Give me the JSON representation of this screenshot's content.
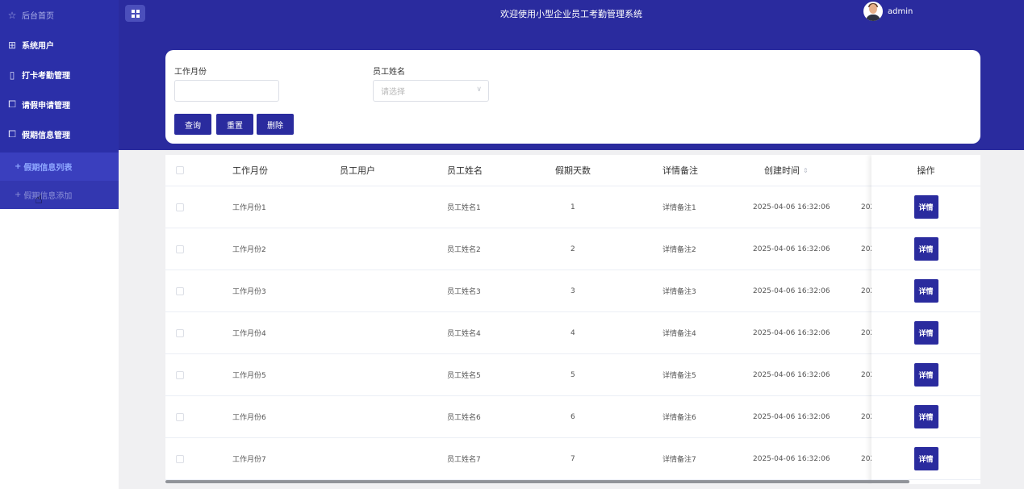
{
  "sidebar": {
    "home": "后台首页",
    "items": [
      {
        "label": "系统用户",
        "icon": "grid-icon"
      },
      {
        "label": "打卡考勤管理",
        "icon": "document-icon"
      },
      {
        "label": "请假申请管理",
        "icon": "form-icon"
      },
      {
        "label": "假期信息管理",
        "icon": "form-icon"
      }
    ],
    "sub_items": [
      {
        "label": "假期信息列表"
      },
      {
        "label": "假期信息添加"
      }
    ]
  },
  "header": {
    "title": "欢迎使用小型企业员工考勤管理系统",
    "username": "admin"
  },
  "search": {
    "month_label": "工作月份",
    "month_value": "",
    "name_label": "员工姓名",
    "name_placeholder": "请选择",
    "query_btn": "查询",
    "reset_btn": "重置",
    "delete_btn": "删除"
  },
  "table": {
    "headers": [
      "工作月份",
      "员工用户",
      "员工姓名",
      "假期天数",
      "详情备注",
      "创建时间",
      "操作"
    ],
    "rows": [
      {
        "month": "工作月份1",
        "user": "",
        "name": "员工姓名1",
        "days": "1",
        "remark": "详情备注1",
        "created": "2025-04-06 16:32:06",
        "extra": "202",
        "action": "详情"
      },
      {
        "month": "工作月份2",
        "user": "",
        "name": "员工姓名2",
        "days": "2",
        "remark": "详情备注2",
        "created": "2025-04-06 16:32:06",
        "extra": "202",
        "action": "详情"
      },
      {
        "month": "工作月份3",
        "user": "",
        "name": "员工姓名3",
        "days": "3",
        "remark": "详情备注3",
        "created": "2025-04-06 16:32:06",
        "extra": "202",
        "action": "详情"
      },
      {
        "month": "工作月份4",
        "user": "",
        "name": "员工姓名4",
        "days": "4",
        "remark": "详情备注4",
        "created": "2025-04-06 16:32:06",
        "extra": "202",
        "action": "详情"
      },
      {
        "month": "工作月份5",
        "user": "",
        "name": "员工姓名5",
        "days": "5",
        "remark": "详情备注5",
        "created": "2025-04-06 16:32:06",
        "extra": "202",
        "action": "详情"
      },
      {
        "month": "工作月份6",
        "user": "",
        "name": "员工姓名6",
        "days": "6",
        "remark": "详情备注6",
        "created": "2025-04-06 16:32:06",
        "extra": "202",
        "action": "详情"
      },
      {
        "month": "工作月份7",
        "user": "",
        "name": "员工姓名7",
        "days": "7",
        "remark": "详情备注7",
        "created": "2025-04-06 16:32:06",
        "extra": "202",
        "action": "详情"
      }
    ]
  },
  "colors": {
    "primary": "#2a2b9e",
    "sidebar": "#2b2fa8",
    "submenu": "#3a3fbe"
  }
}
